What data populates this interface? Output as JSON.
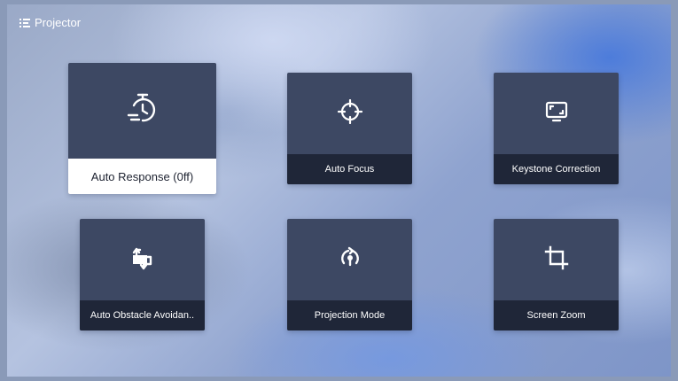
{
  "header": {
    "icon": "menu-list-icon",
    "title": "Projector"
  },
  "tiles": [
    {
      "label": "Auto Response (0ff)",
      "icon": "timer-icon",
      "focused": true
    },
    {
      "label": "Auto Focus",
      "icon": "crosshair-icon",
      "focused": false
    },
    {
      "label": "Keystone Correction",
      "icon": "keystone-screen-icon",
      "focused": false
    },
    {
      "label": "Auto Obstacle Avoidan..",
      "icon": "obstacle-avoidance-icon",
      "focused": false
    },
    {
      "label": "Projection Mode",
      "icon": "projection-mode-icon",
      "focused": false
    },
    {
      "label": "Screen Zoom",
      "icon": "crop-icon",
      "focused": false
    }
  ],
  "colors": {
    "tile_bg": "#3d4863",
    "label_bg": "#1f2638",
    "focused_label_bg": "#ffffff",
    "focused_label_text": "#1d2230"
  }
}
